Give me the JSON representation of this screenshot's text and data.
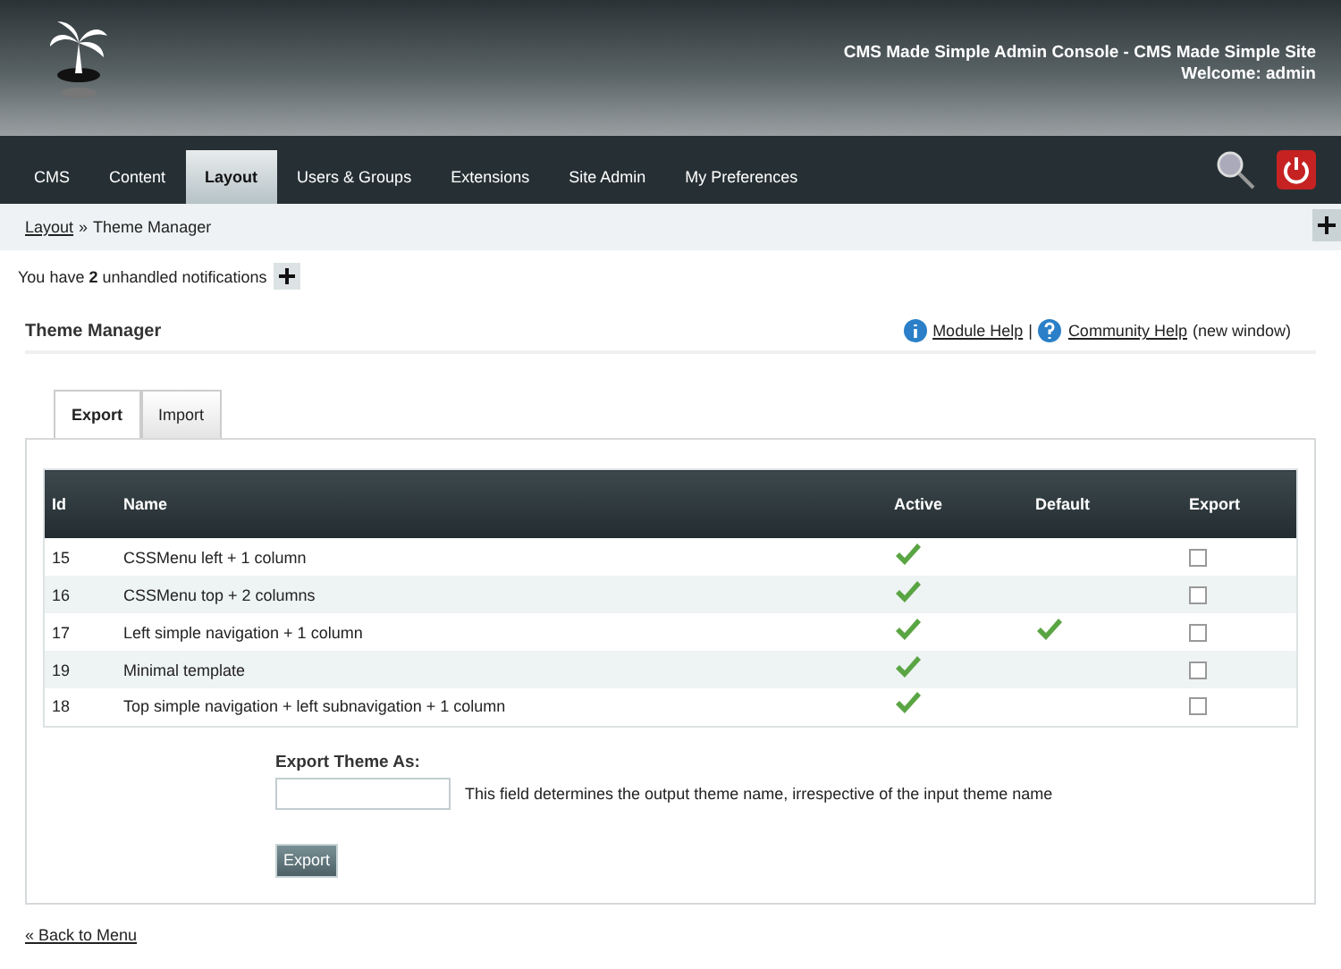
{
  "header": {
    "title": "CMS Made Simple Admin Console - CMS Made Simple Site",
    "welcome": "Welcome: admin"
  },
  "nav": [
    {
      "label": "CMS",
      "selected": false
    },
    {
      "label": "Content",
      "selected": false
    },
    {
      "label": "Layout",
      "selected": true
    },
    {
      "label": "Users & Groups",
      "selected": false
    },
    {
      "label": "Extensions",
      "selected": false
    },
    {
      "label": "Site Admin",
      "selected": false
    },
    {
      "label": "My Preferences",
      "selected": false
    }
  ],
  "breadcrumb": {
    "link": "Layout",
    "separator": "»",
    "current": "Theme Manager"
  },
  "notifications": {
    "text": "You have **2** unhandled notifications"
  },
  "page": {
    "title": "Theme Manager",
    "module_help": "Module Help",
    "separator": "|",
    "community_help": "Community Help",
    "note": "(new window)"
  },
  "tabs": [
    {
      "label": "Export",
      "selected": true
    },
    {
      "label": "Import",
      "selected": false
    }
  ],
  "table": {
    "columns": [
      "Id",
      "Name",
      "Active",
      "Default",
      "Export"
    ],
    "rows": [
      {
        "id": "15",
        "name": "CSSMenu left + 1 column",
        "active": true,
        "default": false,
        "export": false
      },
      {
        "id": "16",
        "name": "CSSMenu top + 2 columns",
        "active": true,
        "default": false,
        "export": false
      },
      {
        "id": "17",
        "name": "Left simple navigation + 1 column",
        "active": true,
        "default": true,
        "export": false
      },
      {
        "id": "19",
        "name": "Minimal template",
        "active": true,
        "default": false,
        "export": false
      },
      {
        "id": "18",
        "name": "Top simple navigation + left subnavigation + 1 column",
        "active": true,
        "default": false,
        "export": false
      }
    ]
  },
  "export_form": {
    "label": "Export Theme As:",
    "hint": "This field determines the output theme name, irrespective of the input theme name",
    "button": "Export"
  },
  "back_link": "« Back to Menu"
}
